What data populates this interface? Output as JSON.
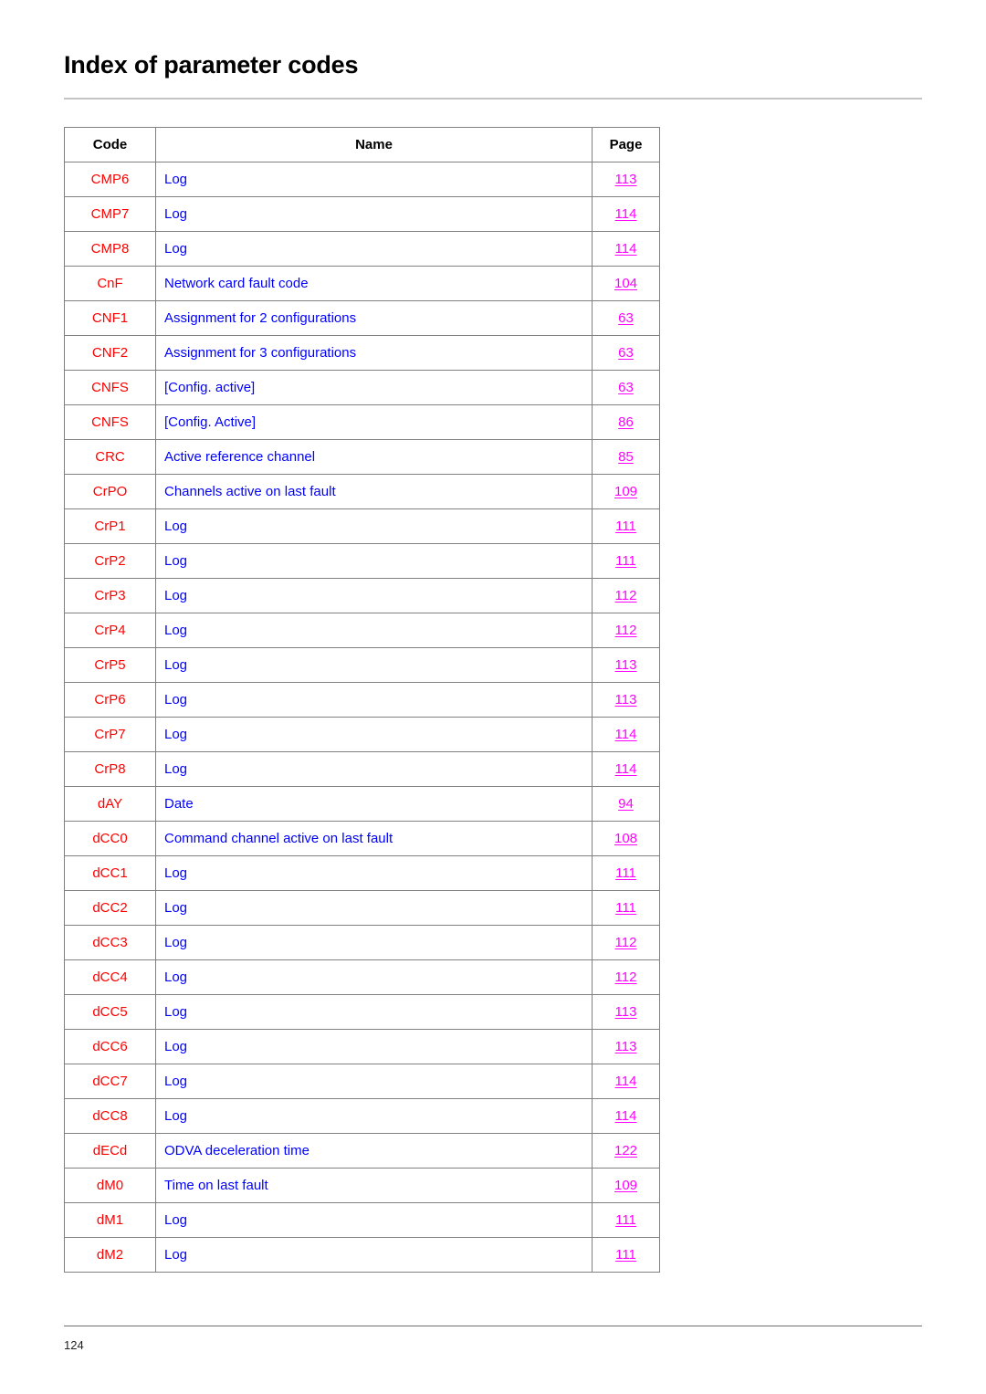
{
  "document": {
    "title": "Index of parameter codes",
    "footer_page_number": "124"
  },
  "colors": {
    "code_text": "#ff0000",
    "name_text": "#0000ff",
    "page_link": "#ff00ff",
    "header_text": "#000000",
    "table_border": "#808080",
    "rule": "#c4c4c4"
  },
  "table": {
    "columns": [
      {
        "key": "code",
        "label": "Code"
      },
      {
        "key": "name",
        "label": "Name"
      },
      {
        "key": "page",
        "label": "Page"
      }
    ],
    "rows": [
      {
        "code": "CMP6",
        "name": "Log",
        "page": "113"
      },
      {
        "code": "CMP7",
        "name": "Log",
        "page": "114"
      },
      {
        "code": "CMP8",
        "name": "Log",
        "page": "114"
      },
      {
        "code": "CnF",
        "name": "Network card fault code",
        "page": "104"
      },
      {
        "code": "CNF1",
        "name": "Assignment for 2 configurations",
        "page": "63"
      },
      {
        "code": "CNF2",
        "name": "Assignment for 3 configurations",
        "page": "63"
      },
      {
        "code": "CNFS",
        "name": "[Config. active]",
        "page": "63"
      },
      {
        "code": "CNFS",
        "name": "[Config. Active]",
        "page": "86"
      },
      {
        "code": "CRC",
        "name": "Active reference channel",
        "page": "85"
      },
      {
        "code": "CrPO",
        "name": "Channels active on last fault",
        "page": "109"
      },
      {
        "code": "CrP1",
        "name": "Log",
        "page": "111"
      },
      {
        "code": "CrP2",
        "name": "Log",
        "page": "111"
      },
      {
        "code": "CrP3",
        "name": "Log",
        "page": "112"
      },
      {
        "code": "CrP4",
        "name": "Log",
        "page": "112"
      },
      {
        "code": "CrP5",
        "name": "Log",
        "page": "113"
      },
      {
        "code": "CrP6",
        "name": "Log",
        "page": "113"
      },
      {
        "code": "CrP7",
        "name": "Log",
        "page": "114"
      },
      {
        "code": "CrP8",
        "name": "Log",
        "page": "114"
      },
      {
        "code": "dAY",
        "name": "Date",
        "page": "94"
      },
      {
        "code": "dCC0",
        "name": "Command channel active on last fault",
        "page": "108"
      },
      {
        "code": "dCC1",
        "name": "Log",
        "page": "111"
      },
      {
        "code": "dCC2",
        "name": "Log",
        "page": "111"
      },
      {
        "code": "dCC3",
        "name": "Log",
        "page": "112"
      },
      {
        "code": "dCC4",
        "name": "Log",
        "page": "112"
      },
      {
        "code": "dCC5",
        "name": "Log",
        "page": "113"
      },
      {
        "code": "dCC6",
        "name": "Log",
        "page": "113"
      },
      {
        "code": "dCC7",
        "name": "Log",
        "page": "114"
      },
      {
        "code": "dCC8",
        "name": "Log",
        "page": "114"
      },
      {
        "code": "dECd",
        "name": "ODVA deceleration time",
        "page": "122"
      },
      {
        "code": "dM0",
        "name": "Time on last fault",
        "page": "109"
      },
      {
        "code": "dM1",
        "name": "Log",
        "page": "111"
      },
      {
        "code": "dM2",
        "name": "Log",
        "page": "111"
      }
    ]
  }
}
